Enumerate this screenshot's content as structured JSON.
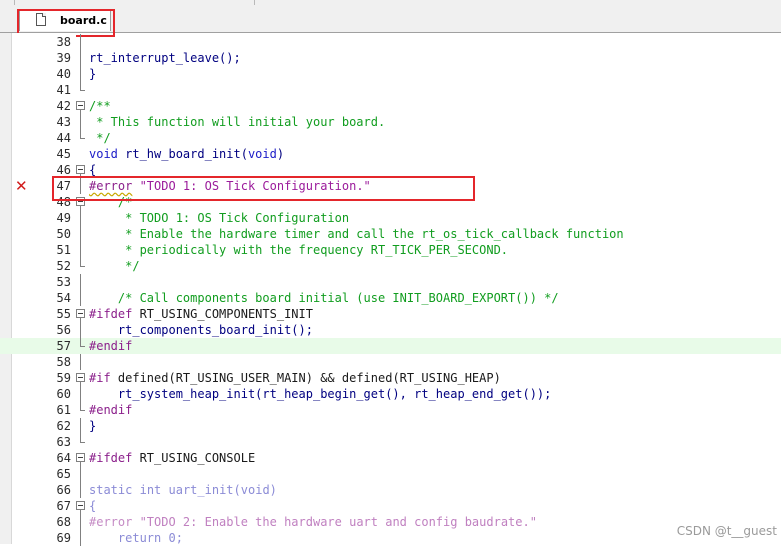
{
  "tab": {
    "label": "board.c"
  },
  "code_lines": [
    {
      "num": "38",
      "fold": "bar",
      "parts": []
    },
    {
      "num": "39",
      "fold": "bar",
      "indent": "ind1",
      "parts": [
        {
          "t": "rt_interrupt_leave();",
          "c": "c-normal"
        }
      ]
    },
    {
      "num": "40",
      "fold": "bar",
      "parts": [
        {
          "t": "}",
          "c": "c-normal"
        }
      ]
    },
    {
      "num": "41",
      "fold": "end",
      "parts": []
    },
    {
      "num": "42",
      "fold": "box",
      "parts": [
        {
          "t": "/**",
          "c": "c-cmt"
        }
      ]
    },
    {
      "num": "43",
      "fold": "bar",
      "parts": [
        {
          "t": " * This function will initial your board.",
          "c": "c-cmt"
        }
      ]
    },
    {
      "num": "44",
      "fold": "end",
      "parts": [
        {
          "t": " */",
          "c": "c-cmt"
        }
      ]
    },
    {
      "num": "45",
      "fold": "none",
      "parts": [
        {
          "t": "void",
          "c": "c-kw"
        },
        {
          "t": " rt_hw_board_init(",
          "c": "c-normal"
        },
        {
          "t": "void",
          "c": "c-kw"
        },
        {
          "t": ")",
          "c": "c-normal"
        }
      ]
    },
    {
      "num": "46",
      "fold": "box",
      "parts": [
        {
          "t": "{",
          "c": "c-normal"
        }
      ]
    },
    {
      "num": "47",
      "fold": "bar",
      "error": true,
      "parts": [
        {
          "t": "#error",
          "c": "c-pre squig"
        },
        {
          "t": " \"TODO 1: OS Tick Configuration.\"",
          "c": "c-str"
        }
      ]
    },
    {
      "num": "48",
      "fold": "box",
      "parts": [
        {
          "t": "    /*",
          "c": "c-cmt"
        }
      ]
    },
    {
      "num": "49",
      "fold": "bar",
      "parts": [
        {
          "t": "     * TODO 1: OS Tick Configuration",
          "c": "c-cmt"
        }
      ]
    },
    {
      "num": "50",
      "fold": "bar",
      "parts": [
        {
          "t": "     * Enable the hardware timer and call the rt_os_tick_callback function",
          "c": "c-cmt"
        }
      ]
    },
    {
      "num": "51",
      "fold": "bar",
      "parts": [
        {
          "t": "     * periodically with the frequency RT_TICK_PER_SECOND.",
          "c": "c-cmt"
        }
      ]
    },
    {
      "num": "52",
      "fold": "end",
      "parts": [
        {
          "t": "     */",
          "c": "c-cmt"
        }
      ]
    },
    {
      "num": "53",
      "fold": "bar",
      "parts": []
    },
    {
      "num": "54",
      "fold": "bar",
      "parts": [
        {
          "t": "    /* Call components board initial (use INIT_BOARD_EXPORT()) */",
          "c": "c-cmt"
        }
      ]
    },
    {
      "num": "55",
      "fold": "box",
      "parts": [
        {
          "t": "#ifdef",
          "c": "c-pre"
        },
        {
          "t": " RT_USING_COMPONENTS_INIT",
          "c": "c-default"
        }
      ]
    },
    {
      "num": "56",
      "fold": "bar",
      "parts": [
        {
          "t": "    rt_components_board_init();",
          "c": "c-normal"
        }
      ]
    },
    {
      "num": "57",
      "fold": "end",
      "current": true,
      "parts": [
        {
          "t": "#endif",
          "c": "c-pre"
        }
      ]
    },
    {
      "num": "58",
      "fold": "bar",
      "parts": []
    },
    {
      "num": "59",
      "fold": "box",
      "parts": [
        {
          "t": "#if",
          "c": "c-pre"
        },
        {
          "t": " defined(RT_USING_USER_MAIN) && defined(RT_USING_HEAP)",
          "c": "c-default"
        }
      ]
    },
    {
      "num": "60",
      "fold": "bar",
      "parts": [
        {
          "t": "    rt_system_heap_init(rt_heap_begin_get(), rt_heap_end_get());",
          "c": "c-normal"
        }
      ]
    },
    {
      "num": "61",
      "fold": "end",
      "parts": [
        {
          "t": "#endif",
          "c": "c-pre"
        }
      ]
    },
    {
      "num": "62",
      "fold": "bar",
      "parts": [
        {
          "t": "}",
          "c": "c-normal"
        }
      ]
    },
    {
      "num": "63",
      "fold": "end",
      "parts": []
    },
    {
      "num": "64",
      "fold": "box",
      "parts": [
        {
          "t": "#ifdef",
          "c": "c-pre"
        },
        {
          "t": " RT_USING_CONSOLE",
          "c": "c-default"
        }
      ]
    },
    {
      "num": "65",
      "fold": "bar",
      "parts": []
    },
    {
      "num": "66",
      "fold": "bar",
      "parts": [
        {
          "t": "static",
          "c": "c-dim"
        },
        {
          "t": " ",
          "c": "c-dim"
        },
        {
          "t": "int",
          "c": "c-dim"
        },
        {
          "t": " uart_init(",
          "c": "c-dim"
        },
        {
          "t": "void",
          "c": "c-dim"
        },
        {
          "t": ")",
          "c": "c-dim"
        }
      ]
    },
    {
      "num": "67",
      "fold": "box",
      "parts": [
        {
          "t": "{",
          "c": "c-dim"
        }
      ]
    },
    {
      "num": "68",
      "fold": "bar",
      "parts": [
        {
          "t": "#error",
          "c": "c-dimpre"
        },
        {
          "t": " \"TODO 2: Enable the hardware uart and config baudrate.\"",
          "c": "c-dimstr"
        }
      ]
    },
    {
      "num": "69",
      "fold": "bar",
      "parts": [
        {
          "t": "    return 0;",
          "c": "c-dim"
        }
      ]
    }
  ],
  "error_icon": "error-x-icon",
  "highlight_color": "#e4262b",
  "watermark": "CSDN @t__guest"
}
